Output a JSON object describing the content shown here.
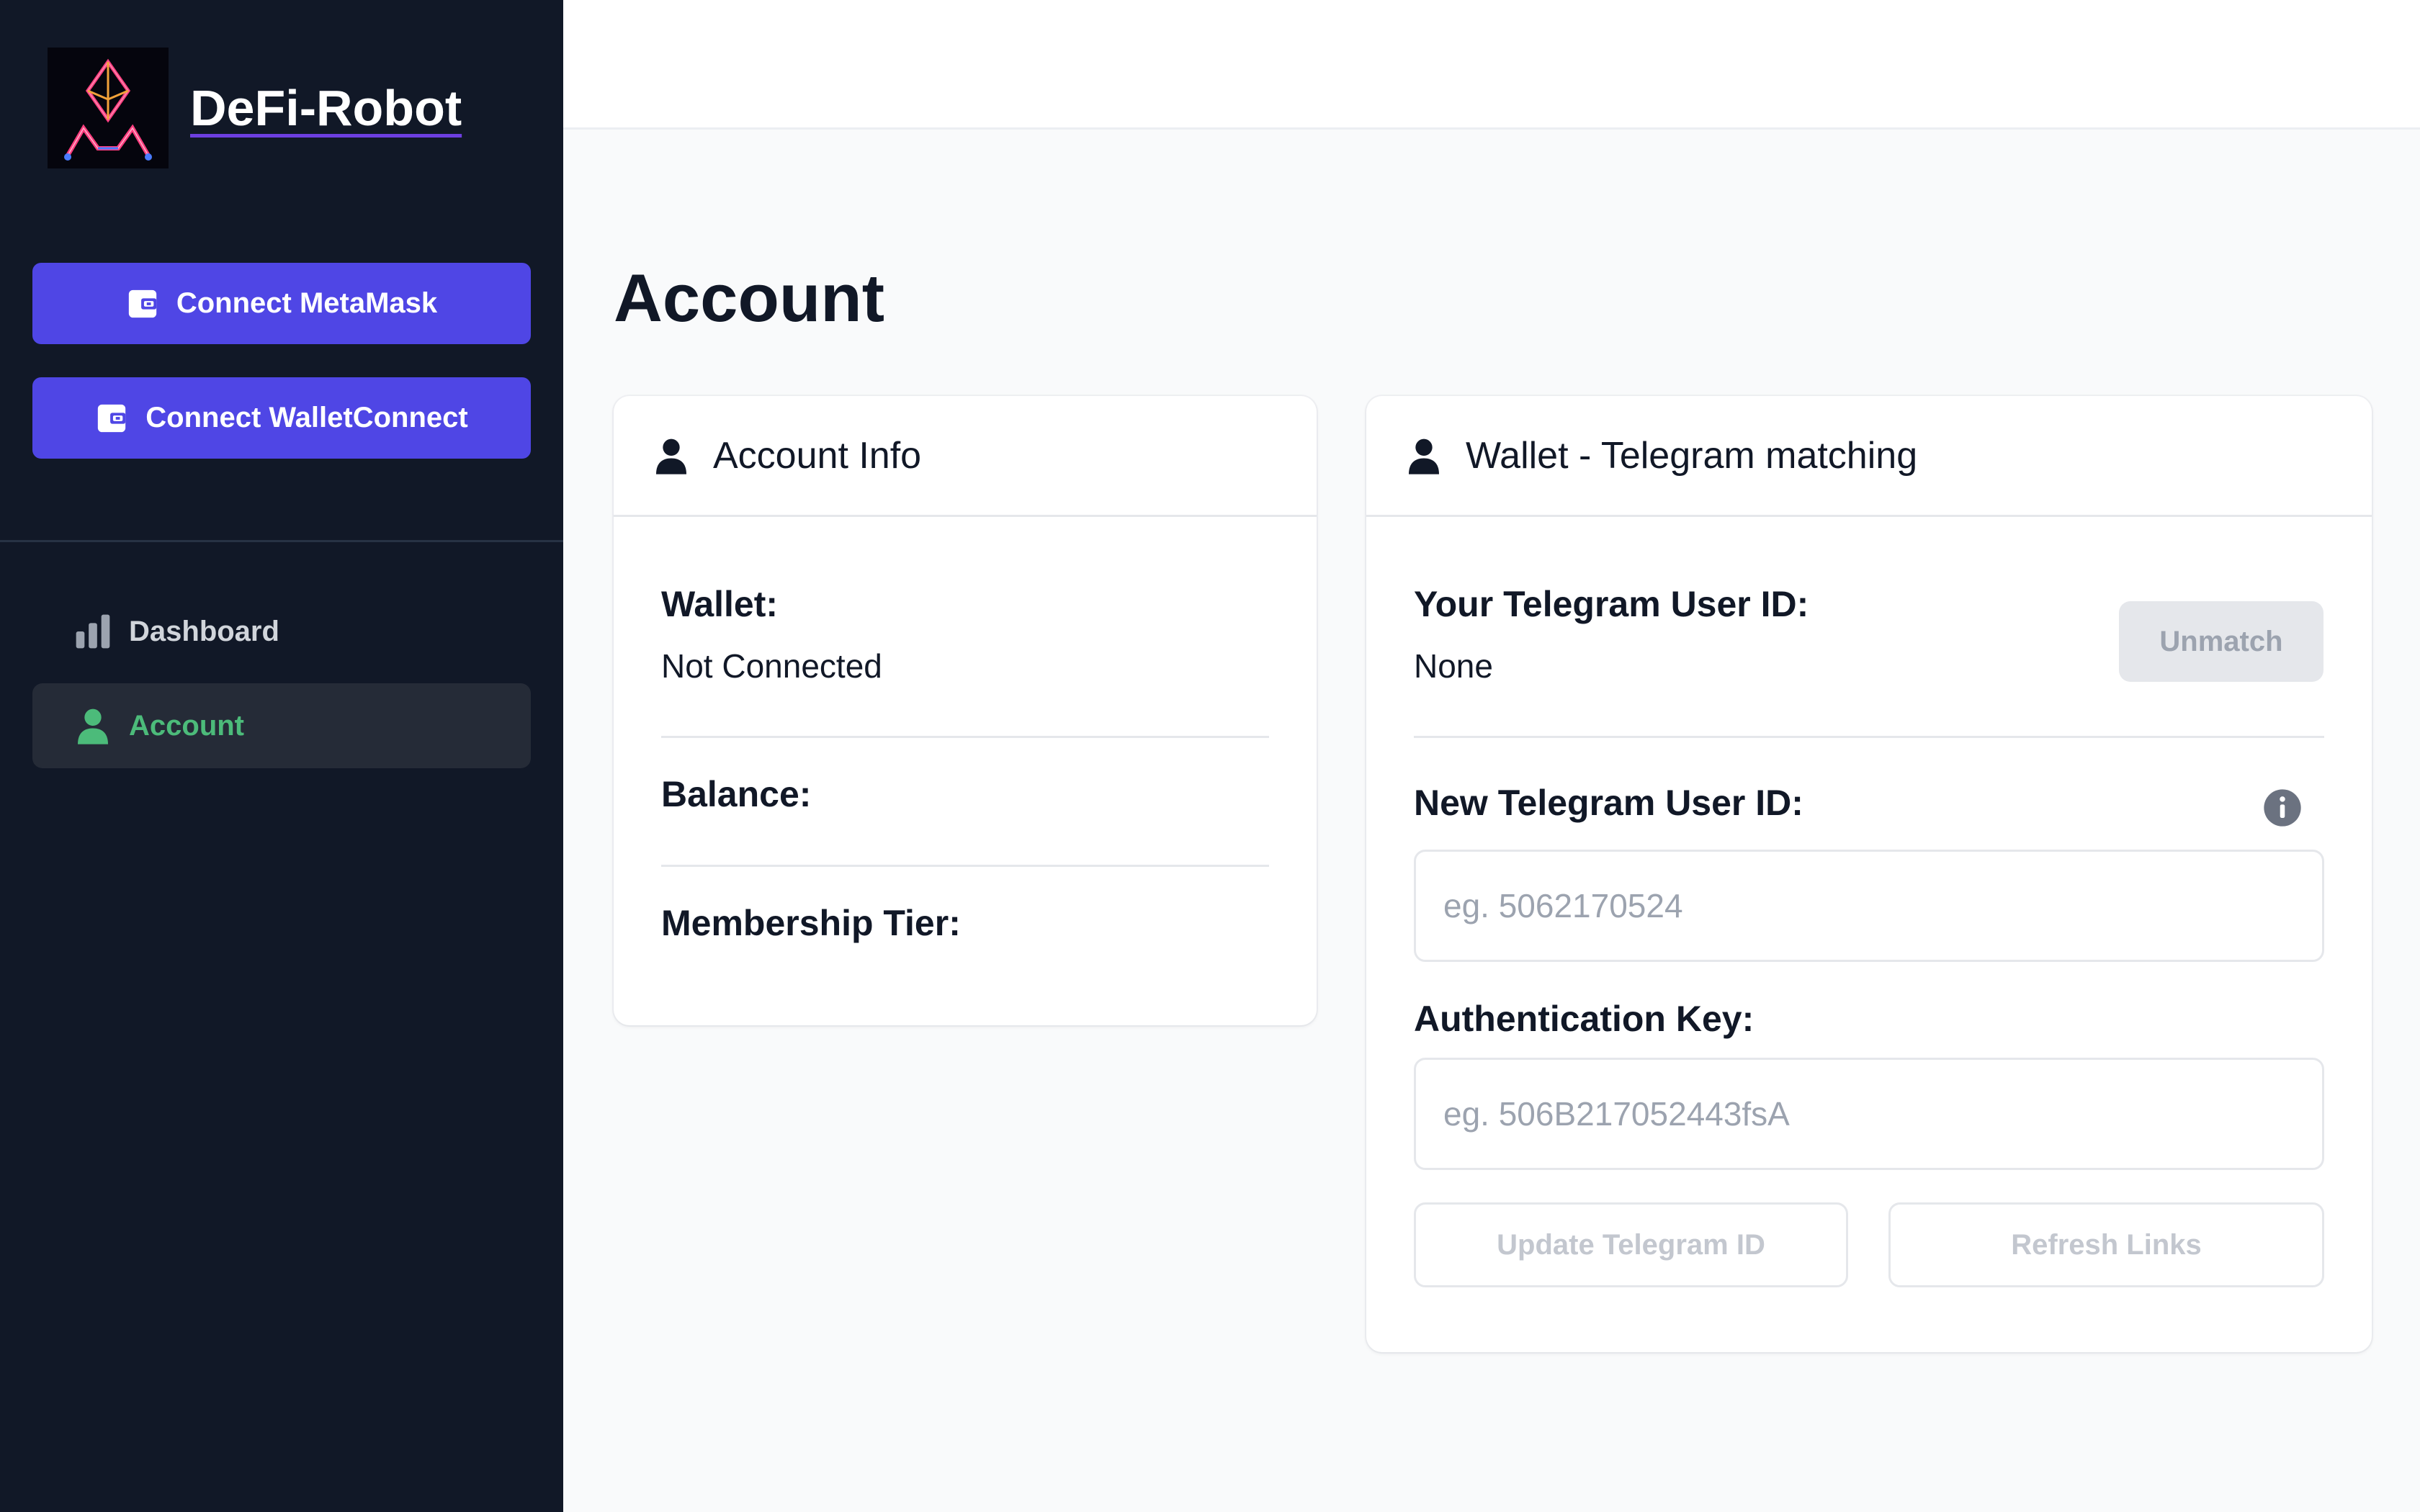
{
  "sidebar": {
    "brand_name": "DeFi-Robot",
    "connect_metamask_label": "Connect MetaMask",
    "connect_walletconnect_label": "Connect WalletConnect",
    "nav": [
      {
        "label": "Dashboard",
        "icon": "bar-chart-icon",
        "active": false
      },
      {
        "label": "Account",
        "icon": "user-icon",
        "active": true
      }
    ]
  },
  "main": {
    "title": "Account",
    "account_info": {
      "title": "Account Info",
      "wallet_label": "Wallet:",
      "wallet_value": "Not Connected",
      "balance_label": "Balance:",
      "membership_label": "Membership Tier:"
    },
    "telegram": {
      "title": "Wallet - Telegram matching",
      "user_id_label": "Your Telegram User ID:",
      "user_id_value": "None",
      "unmatch_label": "Unmatch",
      "new_id_label": "New Telegram User ID:",
      "new_id_placeholder": "eg. 5062170524",
      "auth_key_label": "Authentication Key:",
      "auth_key_placeholder": "eg. 506B217052443fsA",
      "update_label": "Update Telegram ID",
      "refresh_label": "Refresh Links"
    }
  },
  "colors": {
    "sidebar_bg": "#111827",
    "primary": "#4f46e5",
    "active_green": "#4cbb7a",
    "page_bg": "#f9fafb"
  }
}
